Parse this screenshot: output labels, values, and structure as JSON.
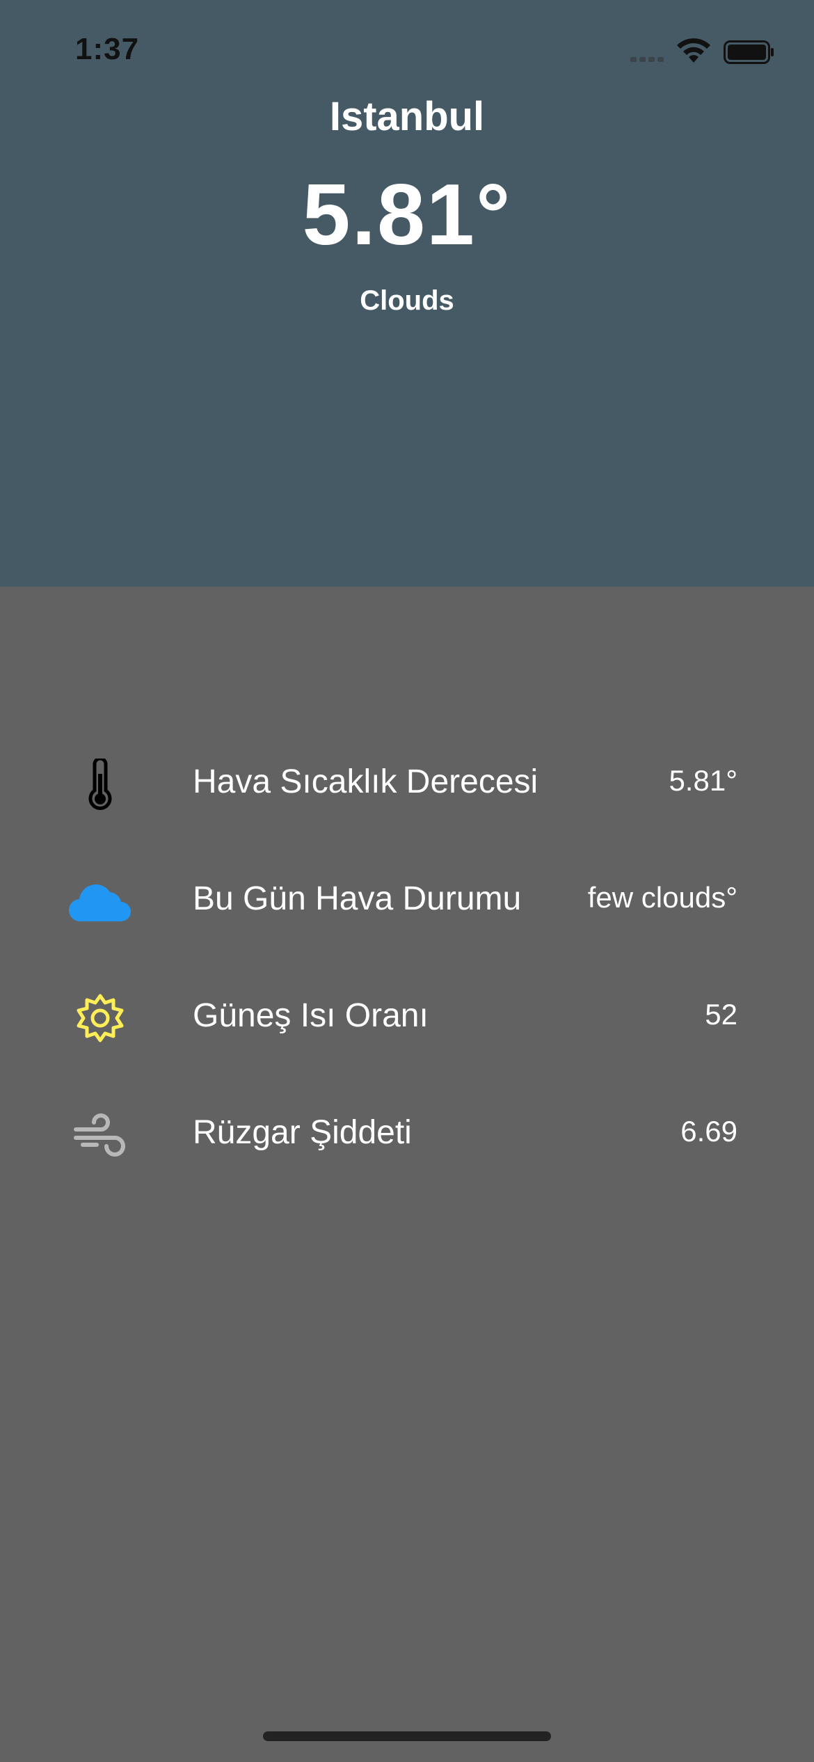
{
  "status_bar": {
    "time": "1:37"
  },
  "header": {
    "city": "Istanbul",
    "temperature": "5.81°",
    "condition": "Clouds"
  },
  "details": [
    {
      "icon": "thermometer-icon",
      "label": "Hava Sıcaklık Derecesi",
      "value": "5.81°"
    },
    {
      "icon": "cloud-icon",
      "label": "Bu Gün Hava Durumu",
      "value": "few clouds°"
    },
    {
      "icon": "sun-icon",
      "label": "Güneş Isı Oranı",
      "value": "52"
    },
    {
      "icon": "wind-icon",
      "label": "Rüzgar Şiddeti",
      "value": "6.69"
    }
  ],
  "colors": {
    "header_bg": "#465a66",
    "body_bg": "#626262",
    "cloud": "#2196f3",
    "sun": "#ffee58",
    "wind": "#b8b8b8"
  }
}
